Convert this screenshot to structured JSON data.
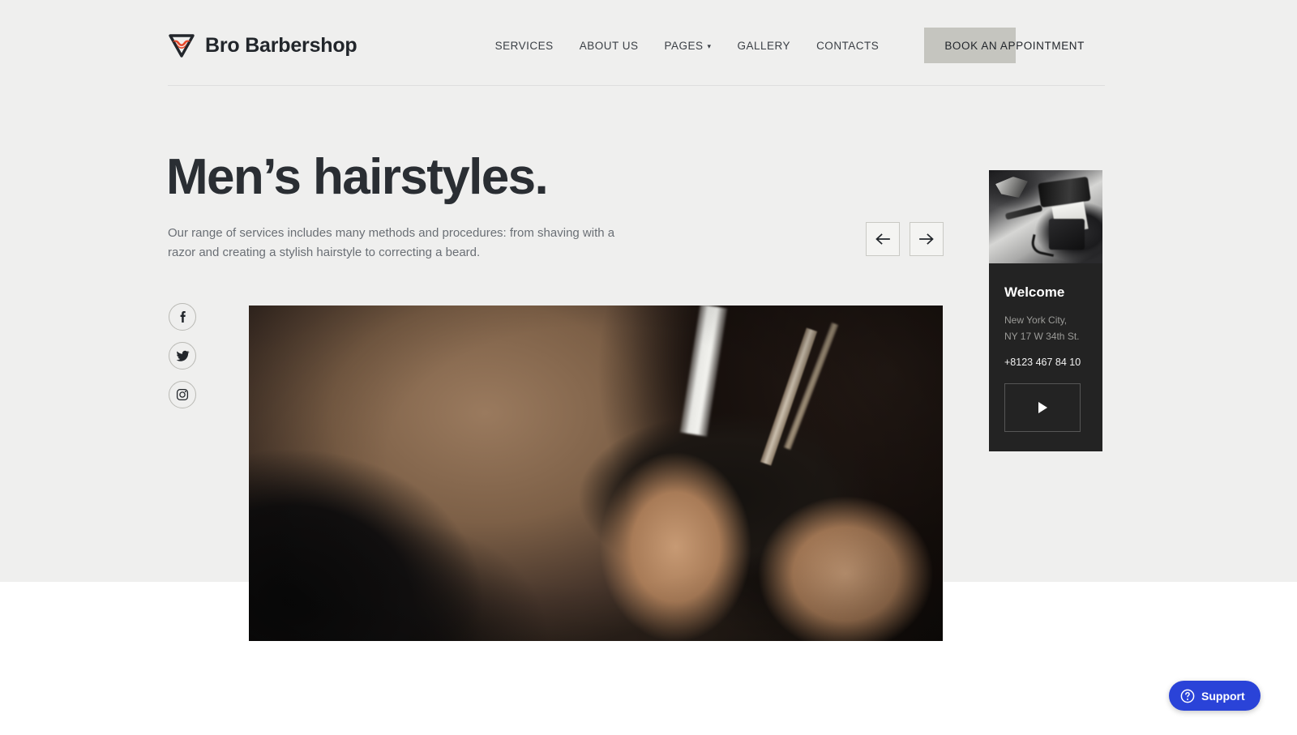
{
  "brand": {
    "name": "Bro Barbershop",
    "logo_icon": "razor-mustache-icon",
    "logo_mustache_color": "#e8492b",
    "logo_triangle_color": "#22262b"
  },
  "nav": {
    "items": [
      {
        "label": "SERVICES",
        "has_caret": false
      },
      {
        "label": "ABOUT US",
        "has_caret": false
      },
      {
        "label": "PAGES",
        "has_caret": true,
        "caret": "▾"
      },
      {
        "label": "GALLERY",
        "has_caret": false
      },
      {
        "label": "CONTACTS",
        "has_caret": false
      }
    ],
    "cta": {
      "label": "BOOK AN APPOINTMENT",
      "highlight_color": "#c5c5bf"
    }
  },
  "hero": {
    "title": "Men’s hairstyles.",
    "subtitle": "Our range of services includes many methods and procedures: from shaving with a razor and creating a stylish hairstyle to correcting a beard.",
    "prev_icon": "arrow-left-icon",
    "next_icon": "arrow-right-icon",
    "background_color": "#efefee",
    "photo_alt": "barber cutting hair with comb and razor"
  },
  "social": {
    "items": [
      {
        "icon": "facebook-icon",
        "name": "facebook"
      },
      {
        "icon": "twitter-icon",
        "name": "twitter"
      },
      {
        "icon": "instagram-icon",
        "name": "instagram"
      }
    ]
  },
  "card": {
    "title": "Welcome",
    "address_line1": "New York City,",
    "address_line2": "NY 17 W 34th St.",
    "phone": "+8123 467 84 10",
    "play_icon": "play-icon",
    "background_color": "#232323",
    "photo_alt": "barber tools scissors clipper comb"
  },
  "support": {
    "label": "Support",
    "icon": "question-circle-icon",
    "color": "#2a43d8"
  }
}
